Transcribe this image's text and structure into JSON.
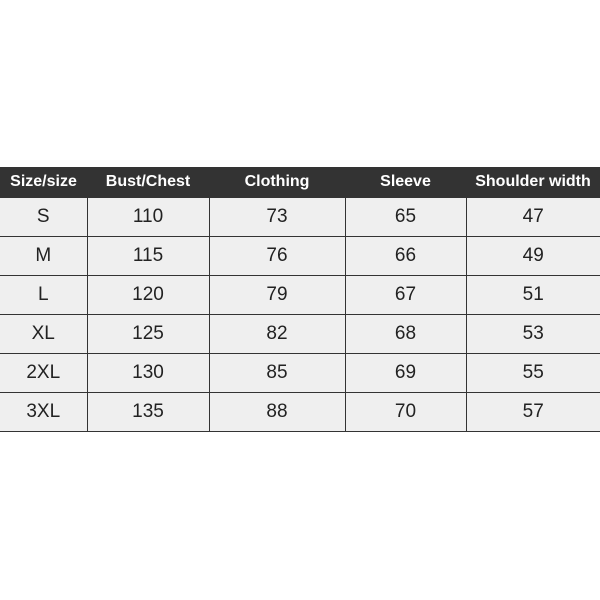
{
  "table": {
    "headers": [
      "Size/size",
      "Bust/Chest",
      "Clothing",
      "Sleeve",
      "Shoulder width"
    ],
    "rows": [
      [
        "S",
        "110",
        "73",
        "65",
        "47"
      ],
      [
        "M",
        "115",
        "76",
        "66",
        "49"
      ],
      [
        "L",
        "120",
        "79",
        "67",
        "51"
      ],
      [
        "XL",
        "125",
        "82",
        "68",
        "53"
      ],
      [
        "2XL",
        "130",
        "85",
        "69",
        "55"
      ],
      [
        "3XL",
        "135",
        "88",
        "70",
        "57"
      ]
    ]
  }
}
